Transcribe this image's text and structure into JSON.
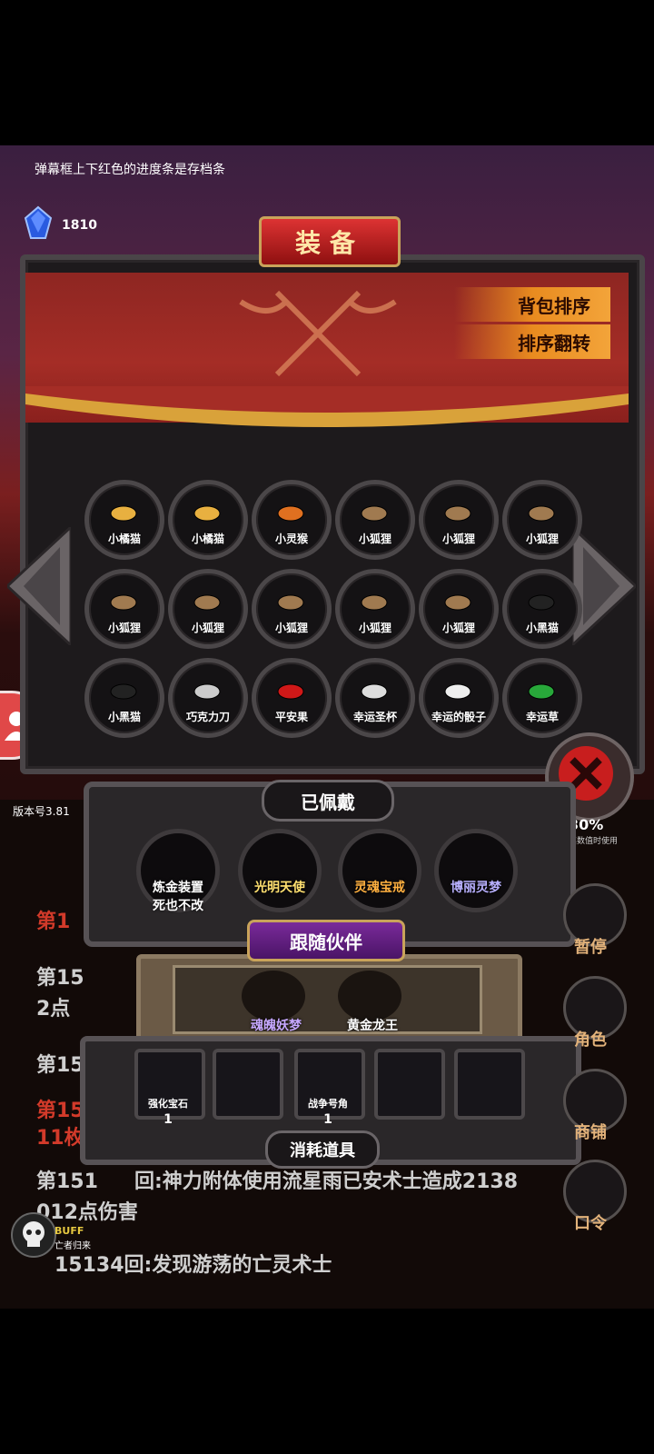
{
  "tip": "弹幕框上下红色的进度条是存档条",
  "gem": {
    "label": "宝石",
    "count": "1810"
  },
  "title": "装备",
  "buttons": {
    "sort_bag": "背包排序",
    "sort_reverse": "排序翻转"
  },
  "inventory": [
    {
      "label": "小橘猫",
      "icon": "cat-orange"
    },
    {
      "label": "小橘猫",
      "icon": "cat-orange"
    },
    {
      "label": "小灵猴",
      "icon": "monkey"
    },
    {
      "label": "小狐狸",
      "icon": "fox"
    },
    {
      "label": "小狐狸",
      "icon": "fox"
    },
    {
      "label": "小狐狸",
      "icon": "fox"
    },
    {
      "label": "小狐狸",
      "icon": "fox"
    },
    {
      "label": "小狐狸",
      "icon": "fox"
    },
    {
      "label": "小狐狸",
      "icon": "fox"
    },
    {
      "label": "小狐狸",
      "icon": "fox"
    },
    {
      "label": "小狐狸",
      "icon": "fox"
    },
    {
      "label": "小黑猫",
      "icon": "cat-black"
    },
    {
      "label": "小黑猫",
      "icon": "cat-black"
    },
    {
      "label": "巧克力刀",
      "icon": "knife"
    },
    {
      "label": "平安果",
      "icon": "apple"
    },
    {
      "label": "幸运圣杯",
      "icon": "grail"
    },
    {
      "label": "幸运的骰子",
      "icon": "dice"
    },
    {
      "label": "幸运草",
      "icon": "clover"
    }
  ],
  "equipped": {
    "title": "已佩戴",
    "items": [
      {
        "label": "炼金装置\n死也不改",
        "color": "#ffffff",
        "icon": "alchemy"
      },
      {
        "label": "光明天使",
        "color": "#ffe070",
        "icon": "angel"
      },
      {
        "label": "灵魂宝戒",
        "color": "#ffb040",
        "icon": "ring"
      },
      {
        "label": "博丽灵梦",
        "color": "#b8b0ff",
        "icon": "shrine-maiden"
      }
    ]
  },
  "companion": {
    "title": "跟随伙伴",
    "items": [
      {
        "label": "魂魄妖梦",
        "color": "#c6a8ff",
        "icon": "swordswoman"
      },
      {
        "label": "黄金龙王",
        "color": "#ffffff",
        "icon": "golden-dragon"
      }
    ]
  },
  "consumables": {
    "title": "消耗道具",
    "items": [
      {
        "label": "强化宝石",
        "count": "1",
        "icon": "green-gem"
      },
      {
        "label": "",
        "count": "",
        "icon": ""
      },
      {
        "label": "战争号角",
        "count": "1",
        "icon": "horn"
      },
      {
        "label": "",
        "count": "",
        "icon": ""
      },
      {
        "label": "",
        "count": "",
        "icon": ""
      }
    ]
  },
  "right_buttons": [
    {
      "label": "暂停",
      "icon": "dice-icon"
    },
    {
      "label": "角色",
      "icon": "hood-icon"
    },
    {
      "label": "商铺",
      "icon": "shop-icon"
    },
    {
      "label": "口令",
      "icon": "scroll-icon"
    }
  ],
  "version": "版本号3.81",
  "right_stat": {
    "value": "30%",
    "note": "其数值时使用"
  },
  "log": {
    "l1": "第1",
    "l2a": "第15",
    "l2b": "2点",
    "l3": "第15",
    "l4a": "第15",
    "l4b": "11枚",
    "l5a": "第151",
    "l5b": "回:神力附体使用流星雨已安术士造成2138",
    "l5c": "012点伤害",
    "l6": "15134回:发现游荡的亡灵术士"
  },
  "buff": {
    "label": "BUFF",
    "sub": "亡者归来"
  }
}
